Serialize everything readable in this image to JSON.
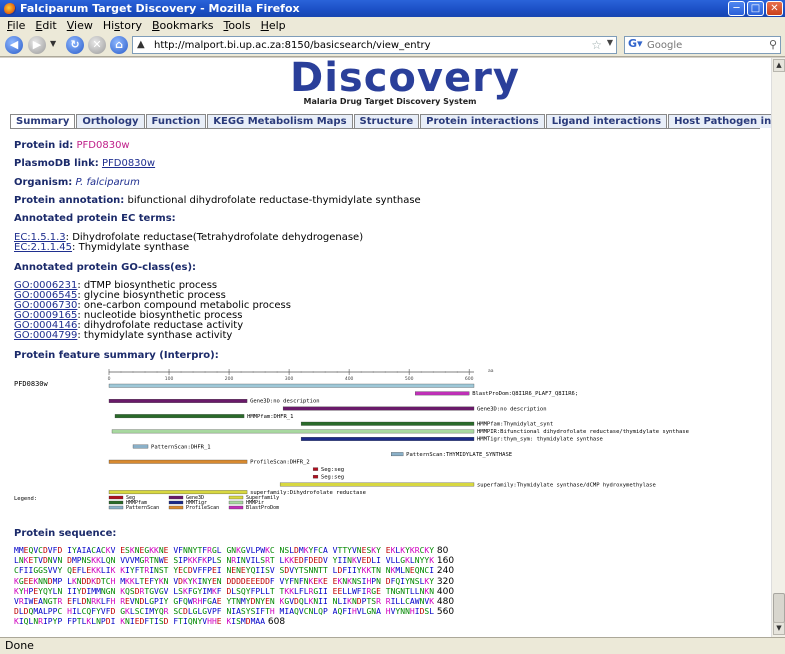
{
  "window": {
    "title": "Falciparum Target Discovery - Mozilla Firefox"
  },
  "menu": [
    {
      "key": "F",
      "rest": "ile"
    },
    {
      "key": "E",
      "rest": "dit"
    },
    {
      "key": "V",
      "rest": "iew"
    },
    {
      "key": "",
      "pre": "Hi",
      "key2": "s",
      "rest": "tory"
    },
    {
      "key": "B",
      "rest": "ookmarks"
    },
    {
      "key": "T",
      "rest": "ools"
    },
    {
      "key": "H",
      "rest": "elp"
    }
  ],
  "nav": {
    "url": "http://malport.bi.up.ac.za:8150/basicsearch/view_entry",
    "search_placeholder": "Google"
  },
  "logo": {
    "word": "Discovery",
    "subtitle": "Malaria Drug Target Discovery System"
  },
  "tabs": [
    "Summary",
    "Orthology",
    "Function",
    "KEGG Metabolism Maps",
    "Structure",
    "Protein interactions",
    "Ligand interactions",
    "Host Pathogen interactions"
  ],
  "summary": {
    "protein_id_label": "Protein id:",
    "protein_id": "PFD0830w",
    "plasmodb_label": "PlasmoDB link:",
    "plasmodb": "PFD0830w",
    "organism_label": "Organism:",
    "organism": "P. falciparum",
    "annotation_label": "Protein annotation:",
    "annotation": "bifunctional dihydrofolate reductase-thymidylate synthase",
    "ec_label": "Annotated protein EC terms:",
    "ec": [
      {
        "id": "EC:1.5.1.3",
        "desc": ": Dihydrofolate reductase(Tetrahydrofolate dehydrogenase)"
      },
      {
        "id": "EC:2.1.1.45",
        "desc": ": Thymidylate synthase"
      }
    ],
    "go_label": "Annotated protein GO-class(es):",
    "go": [
      {
        "id": "GO:0006231",
        "desc": ": dTMP biosynthetic process"
      },
      {
        "id": "GO:0006545",
        "desc": ": glycine biosynthetic process"
      },
      {
        "id": "GO:0006730",
        "desc": ": one-carbon compound metabolic process"
      },
      {
        "id": "GO:0009165",
        "desc": ": nucleotide biosynthetic process"
      },
      {
        "id": "GO:0004146",
        "desc": ": dihydrofolate reductase activity"
      },
      {
        "id": "GO:0004799",
        "desc": ": thymidylate synthase activity"
      }
    ],
    "feature_label": "Protein feature summary (Interpro):",
    "sequence_label": "Protein sequence:"
  },
  "features": {
    "protein": "PFD0830w",
    "axis_unit": "aa",
    "axis_max": 608,
    "ticks": [
      0,
      100,
      200,
      300,
      400,
      500,
      600
    ],
    "colors": {
      "Seg": "#b01020",
      "Gene3D": "#6a1a6a",
      "HMMPfam": "#2a6a2a",
      "HMMTigr": "#1a2a8a",
      "PatternScan": "#8ab0c8",
      "ProfileScan": "#d88a30",
      "Superfamily": "#d8d840",
      "HMMPir": "#a8d8a0",
      "BlastProDom": "#c030b8",
      "Full": "#9ec8d8"
    },
    "tracks": [
      {
        "source": "Full",
        "start": 0,
        "end": 608,
        "label": ""
      },
      {
        "source": "BlastProDom",
        "start": 510,
        "end": 600,
        "label": "BlastProDom:Q8I1R6_PLAF7_Q8I1R6;"
      },
      {
        "source": "Gene3D",
        "start": 0,
        "end": 230,
        "label": "Gene3D:no description"
      },
      {
        "source": "Gene3D",
        "start": 290,
        "end": 608,
        "label": "Gene3D:no description"
      },
      {
        "source": "HMMPfam",
        "start": 10,
        "end": 225,
        "label": "HMMPfam:DHFR_1"
      },
      {
        "source": "HMMPfam",
        "start": 320,
        "end": 608,
        "label": "HMMPfam:Thymidylat_synt"
      },
      {
        "source": "HMMPir",
        "start": 5,
        "end": 608,
        "label": "HMMPIR:Bifunctional dihydrofolate reductase/thymidylate synthase"
      },
      {
        "source": "HMMTigr",
        "start": 320,
        "end": 608,
        "label": "HMMTigr:thym_sym: thymidylate synthase"
      },
      {
        "source": "PatternScan",
        "start": 40,
        "end": 65,
        "label": "PatternScan:DHFR_1"
      },
      {
        "source": "PatternScan",
        "start": 470,
        "end": 490,
        "label": "PatternScan:THYMIDYLATE_SYNTHASE"
      },
      {
        "source": "ProfileScan",
        "start": 0,
        "end": 230,
        "label": "ProfileScan:DHFR_2"
      },
      {
        "source": "Seg",
        "start": 340,
        "end": 348,
        "label": "Seg:seg"
      },
      {
        "source": "Seg",
        "start": 340,
        "end": 348,
        "label": "Seg:seg"
      },
      {
        "source": "Superfamily",
        "start": 285,
        "end": 608,
        "label": "superfamily:Thymidylate synthase/dCMP hydroxymethylase"
      },
      {
        "source": "Superfamily",
        "start": 0,
        "end": 230,
        "label": "superfamily:Dihydrofolate reductase"
      }
    ],
    "legend_label": "Legend:",
    "legend": [
      "Seg",
      "Gene3D",
      "Superfamily",
      "HMMPfam",
      "HMMTigr",
      "HMMPir",
      "PatternScan",
      "ProfileScan",
      "BlastProDom"
    ]
  },
  "sequence": {
    "lines": [
      {
        "seq": "MMEQVCDVFD IYAIACACKV ESKNEGKKNE VFNNYTFRGL GNKGVLPWKC NSLDMKYFCA VTTYVNESKY EKLKYKRCKY",
        "n": "80"
      },
      {
        "seq": "LNKETVDNVN DMPNSKKLQN VVVMGRTNWE SIPKKFKPLS NRINVILSRT LKKEDFDEDV YIINKVEDLI VLLGKLNYYK",
        "n": "160"
      },
      {
        "seq": "CFIIGGSVVY QEFLEKKLIK KIYFTRINST YECDVFFPEI NENEYQIISV SDVYTSNNTT LDFIIYKKTN NKMLNEQNCI",
        "n": "240"
      },
      {
        "seq": "KGEEKNNDMP LKNDDKDTCH MKKLTEFYKN VDKYKINYEN DDDDEEEDDF VYFNFNKEKE EKNKNSIHPN DFQIYNSLKY",
        "n": "320"
      },
      {
        "seq": "KYHPEYQYLN IIYDIMMNGN KQSDRTGVGV LSKFGYIMKF DLSQYFPLLT TKKLFLRGII EELLWFIRGE TNGNTLLNKN",
        "n": "400"
      },
      {
        "seq": "VRIWEANGTR EFLDNRKLFH REVNDLGPIY GFQWRHFGAE YTNMYDNYEN KGVDQLKNII NLIKNDPTSR RILLCAWNVK",
        "n": "480"
      },
      {
        "seq": "DLDQMALPPC HILCQFYVFD GKLSCIMYQR SCDLGLGVPF NIASYSIFTH MIAQVCNLQP AQFIHVLGNA HVYNNHIDSL",
        "n": "560"
      },
      {
        "seq": "KIQLNRIPYP FPTLKLNPDI KNIEDFTISD FTIQNYVHHE KISMDMAA",
        "n": "608"
      }
    ]
  },
  "status": "Done"
}
